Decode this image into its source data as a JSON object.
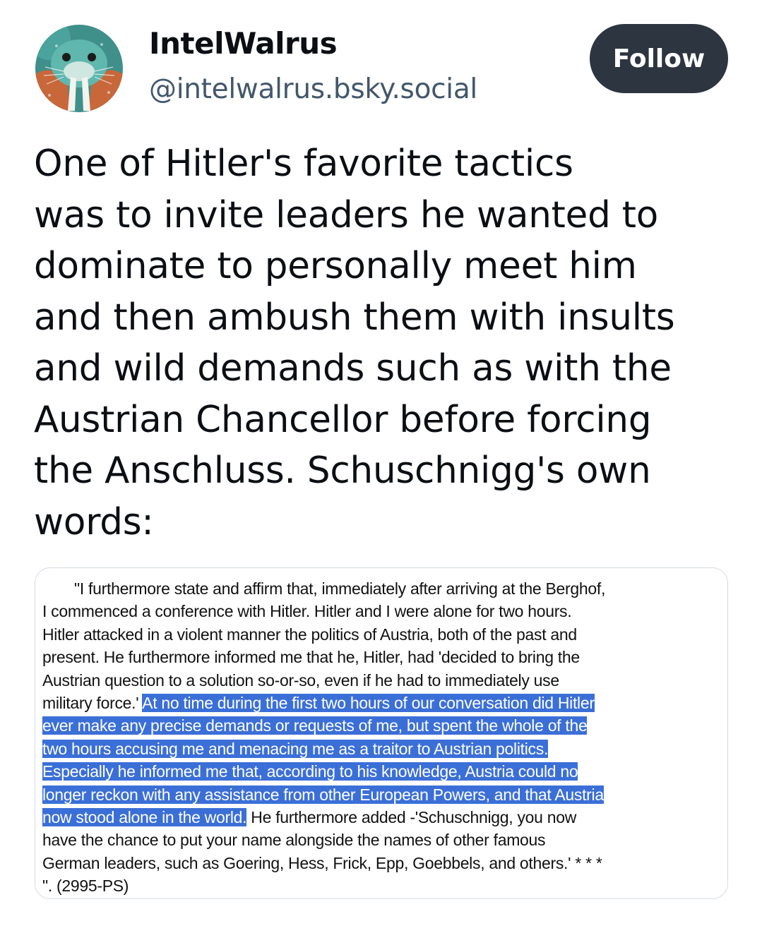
{
  "profile": {
    "display_name": "IntelWalrus",
    "handle": "@intelwalrus.bsky.social",
    "avatar_icon": "walrus-avatar",
    "follow_label": "Follow"
  },
  "post": {
    "lines": [
      "One of Hitler's favorite tactics",
      "was to invite leaders he wanted to",
      "dominate to personally meet him",
      "and then ambush them with insults",
      "and wild demands such as with the",
      "Austrian Chancellor before forcing",
      "the Anschluss. Schuschnigg's own",
      "words:"
    ]
  },
  "quote_image": {
    "line1": "\"I furthermore state and affirm that, immediately after arriving at the Berghof,",
    "line2": "I commenced a conference with Hitler. Hitler and I were alone for two hours.",
    "line3": "Hitler attacked in a violent manner the politics of Austria, both of the past and",
    "line4": "present. He furthermore informed me that he, Hitler, had 'decided to bring the",
    "line5": "Austrian question to a solution so-or-so, even if he had to immediately use",
    "line6_plain": "military force.'",
    "line6_hl": "At no time during the first two hours of our conversation did Hitler",
    "line7_hl": "ever make any precise demands or requests of me, but spent the whole of the",
    "line8_hl": "two hours accusing me and menacing me as a traitor to Austrian politics.",
    "line9_hl": "Especially he informed me that, according to his knowledge, Austria could no",
    "line10_hl": "longer reckon with any assistance from other European Powers, and that Austria",
    "line11_hl": "now stood alone in the world.",
    "line11_plain": " He furthermore added -'Schuschnigg, you now",
    "line12": "have the chance to put your name alongside the names of other famous",
    "line13": "German leaders, such as Goering, Hess, Frick, Epp, Goebbels, and others.' * * *",
    "line14": "\". (2995-PS)",
    "highlight_color": "#3b6fd8"
  },
  "colors": {
    "follow_bg": "#2c3540",
    "handle": "#42576c",
    "text": "#0b0f14"
  }
}
